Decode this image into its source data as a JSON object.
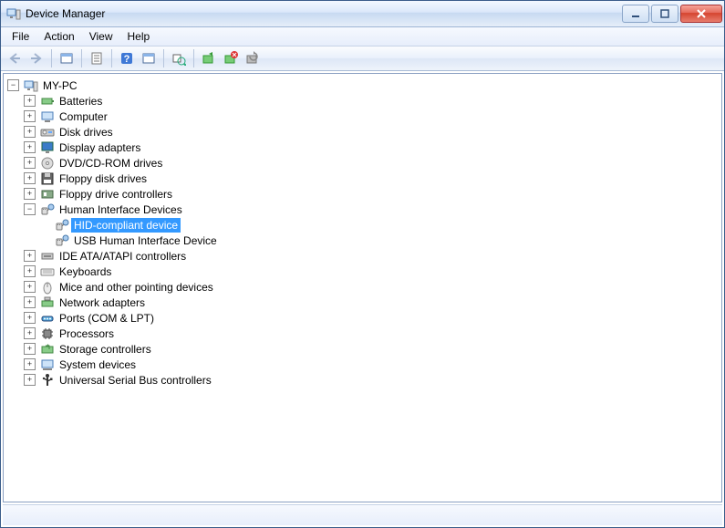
{
  "window": {
    "title": "Device Manager"
  },
  "menu": {
    "file": "File",
    "action": "Action",
    "view": "View",
    "help": "Help"
  },
  "tree": {
    "root": "MY-PC",
    "root_expanded": true,
    "categories": [
      {
        "label": "Batteries",
        "icon": "battery",
        "expanded": false
      },
      {
        "label": "Computer",
        "icon": "computer",
        "expanded": false
      },
      {
        "label": "Disk drives",
        "icon": "disk",
        "expanded": false
      },
      {
        "label": "Display adapters",
        "icon": "display",
        "expanded": false
      },
      {
        "label": "DVD/CD-ROM drives",
        "icon": "dvd",
        "expanded": false
      },
      {
        "label": "Floppy disk drives",
        "icon": "floppy",
        "expanded": false
      },
      {
        "label": "Floppy drive controllers",
        "icon": "floppyctl",
        "expanded": false
      },
      {
        "label": "Human Interface Devices",
        "icon": "hid",
        "expanded": true,
        "children": [
          {
            "label": "HID-compliant device",
            "icon": "hid",
            "selected": true
          },
          {
            "label": "USB Human Interface Device",
            "icon": "hid",
            "selected": false
          }
        ]
      },
      {
        "label": "IDE ATA/ATAPI controllers",
        "icon": "ide",
        "expanded": false
      },
      {
        "label": "Keyboards",
        "icon": "keyboard",
        "expanded": false
      },
      {
        "label": "Mice and other pointing devices",
        "icon": "mouse",
        "expanded": false
      },
      {
        "label": "Network adapters",
        "icon": "network",
        "expanded": false
      },
      {
        "label": "Ports (COM & LPT)",
        "icon": "port",
        "expanded": false
      },
      {
        "label": "Processors",
        "icon": "cpu",
        "expanded": false
      },
      {
        "label": "Storage controllers",
        "icon": "storage",
        "expanded": false
      },
      {
        "label": "System devices",
        "icon": "system",
        "expanded": false
      },
      {
        "label": "Universal Serial Bus controllers",
        "icon": "usb",
        "expanded": false
      }
    ]
  }
}
